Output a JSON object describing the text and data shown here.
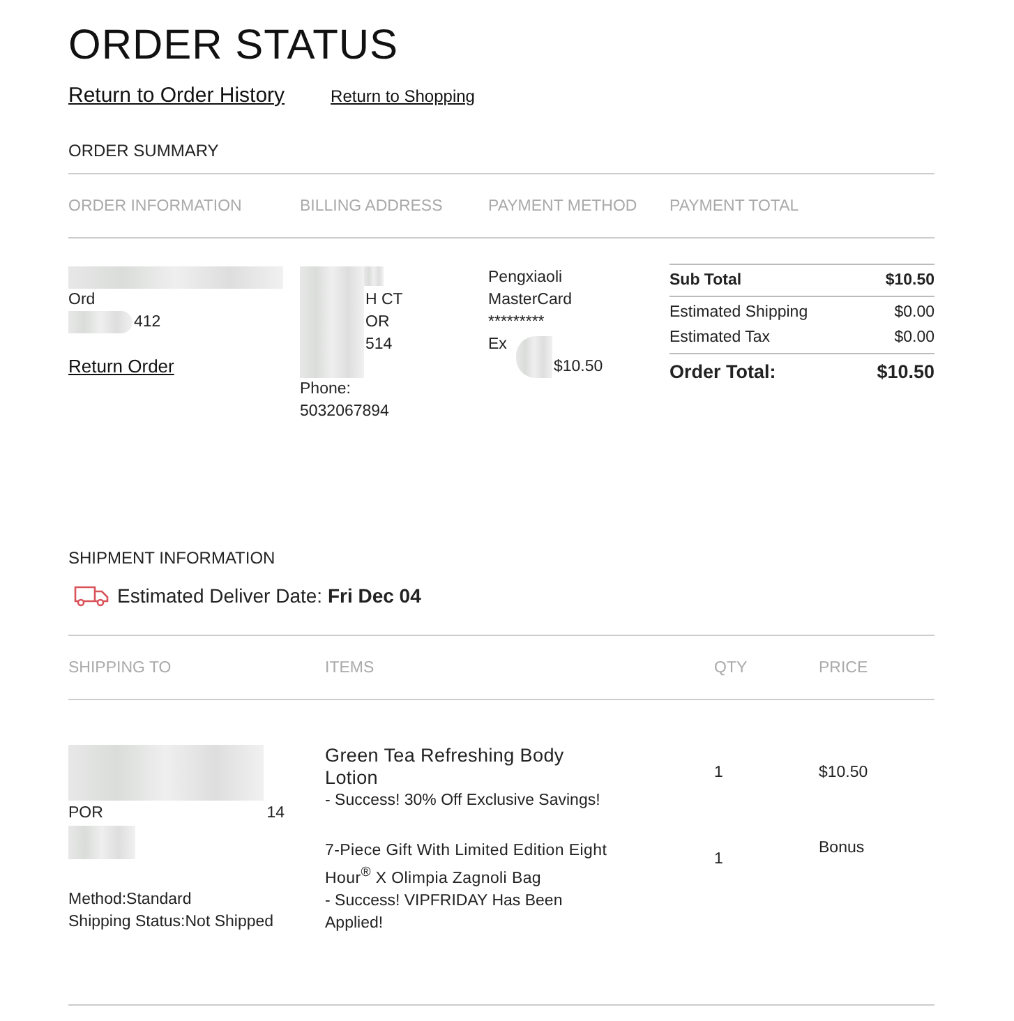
{
  "title": "ORDER STATUS",
  "links": [
    {
      "label": "Return to Order History",
      "kind": "primary"
    },
    {
      "label": "Return to Shopping",
      "kind": "secondary"
    }
  ],
  "summary": {
    "heading": "ORDER SUMMARY",
    "columns": [
      "ORDER INFORMATION",
      "BILLING ADDRESS",
      "PAYMENT METHOD",
      "PAYMENT TOTAL"
    ],
    "order_info": {
      "lines": [
        {
          "text": "Ord",
          "kind": "full"
        },
        {
          "text": "412",
          "kind": "partial"
        }
      ],
      "link": "Return Order"
    },
    "billing_address": {
      "lines": [
        {
          "text": "H CT",
          "kind": "partial"
        },
        {
          "text": "OR",
          "kind": "partial"
        },
        {
          "text": "514",
          "kind": "partial"
        },
        {
          "kind": "gap"
        },
        {
          "text": "Phone:",
          "kind": "full"
        },
        {
          "text": "5032067894",
          "kind": "full"
        }
      ]
    },
    "payment_method": {
      "lines": [
        {
          "text": "Pengxiaoli",
          "kind": "full"
        },
        {
          "text": "MasterCard",
          "kind": "full"
        },
        {
          "text": "*********",
          "kind": "full"
        },
        {
          "text": "Ex",
          "kind": "full"
        },
        {
          "text": "$10.50",
          "kind": "partial"
        }
      ]
    },
    "totals": [
      {
        "label": "Sub Total",
        "value": "$10.50",
        "kind": "subtotal"
      },
      {
        "label": "Estimated Shipping",
        "value": "$0.00",
        "kind": "line"
      },
      {
        "label": "Estimated Tax",
        "value": "$0.00",
        "kind": "line"
      },
      {
        "label": "Order Total:",
        "value": "$10.50",
        "kind": "total"
      }
    ]
  },
  "shipment": {
    "heading": "SHIPMENT INFORMATION",
    "delivery_label": "Estimated Deliver Date:",
    "delivery_date": "Fri Dec 04",
    "columns": [
      "SHIPPING TO",
      "ITEMS",
      "QTY",
      "PRICE"
    ],
    "shipping_to": {
      "city": "POR",
      "zip": "14",
      "method": "Method:Standard",
      "status": "Shipping Status:Not Shipped"
    },
    "items": [
      {
        "name": "Green Tea Refreshing Body Lotion",
        "promo": "- Success! 30% Off Exclusive Savings!",
        "qty": "1",
        "price": "$10.50"
      },
      {
        "name": "7-Piece Gift With Limited Edition Eight Hour$^{®}$ X Olimpia Zagnoli Bag",
        "promo": "- Success! VIPFRIDAY Has Been Applied!",
        "qty": "1",
        "price": "Bonus"
      }
    ]
  }
}
